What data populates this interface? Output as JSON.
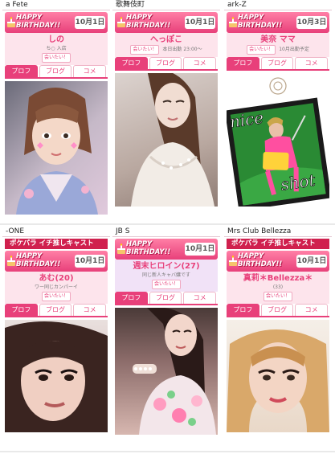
{
  "colors": {
    "accent": "#e8407a",
    "banner_pink": "#ff7fa6",
    "band_pink": "#fde4ec",
    "rec_red": "#d0204e"
  },
  "banner_text_line1": "HAPPY",
  "banner_text_line2": "BIRTHDAY!!",
  "recommend_text": "ポケパラ イチ推しキャスト",
  "cards": [
    {
      "shop": "a Fete",
      "date": "10月1日",
      "name": "しの",
      "meta": "ち○ 入店",
      "want_label": "会いたい！",
      "tabs": [
        "プロフ",
        "ブログ",
        "コメ"
      ],
      "photo_desc": "woman-with-cat-ears"
    },
    {
      "shop": "歌舞伎町",
      "date": "10月1日",
      "name": "へっぽこ",
      "meta": "本日出勤 23:00〜",
      "want_label": "会いたい！",
      "tabs": [
        "プロフ",
        "ブログ",
        "コメ"
      ],
      "photo_desc": "woman-in-white-dress"
    },
    {
      "shop": "ark-Z",
      "date": "10月3日",
      "name": "美奈 ママ",
      "meta": "10月出勤予定",
      "want_label": "会いたい！",
      "tabs": [
        "プロフ",
        "ブログ",
        "コメ"
      ],
      "photo_desc": "nice-shot-golf",
      "photo_text1": "nice",
      "photo_text2": "shot"
    },
    {
      "shop": "-ONE",
      "date": "10月1日",
      "name": "あむ(20)",
      "meta": "ワー同じカンパーイ",
      "want_label": "会いたい！",
      "tabs": [
        "プロフ",
        "ブログ",
        "コメ"
      ],
      "photo_desc": "woman-portrait-dark-hair"
    },
    {
      "shop": "JB S",
      "date": "10月1日",
      "name": "週末ヒロイン(27)",
      "meta": "同じ新人キャバ嬢です",
      "want_label": "会いたい！",
      "tabs": [
        "プロフ",
        "ブログ",
        "コメ"
      ],
      "photo_desc": "woman-in-floral-dress"
    },
    {
      "shop": "Mrs Club Bellezza",
      "date": "10月1日",
      "name": "真莉＊Bellezza＊",
      "meta": "(33)",
      "want_label": "会いたい！",
      "tabs": [
        "プロフ",
        "ブログ",
        "コメ"
      ],
      "photo_desc": "woman-with-blonde-hair"
    }
  ]
}
